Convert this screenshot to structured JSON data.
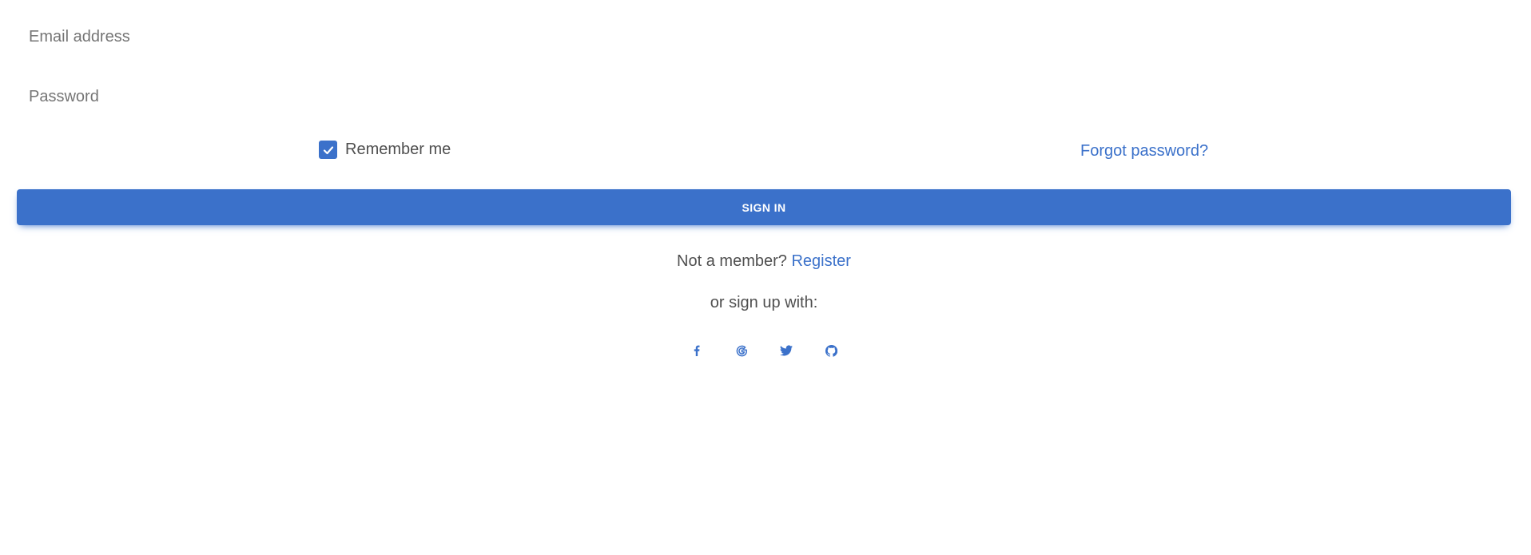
{
  "form": {
    "email": {
      "placeholder": "Email address",
      "value": ""
    },
    "password": {
      "placeholder": "Password",
      "value": ""
    },
    "remember_label": "Remember me",
    "remember_checked": true,
    "forgot_label": "Forgot password?",
    "signin_label": "SIGN IN"
  },
  "register": {
    "prompt": "Not a member?",
    "link_label": "Register"
  },
  "signup": {
    "text": "or sign up with:",
    "icons": [
      "facebook-icon",
      "google-icon",
      "twitter-icon",
      "github-icon"
    ]
  },
  "colors": {
    "primary": "#3b71ca",
    "text": "#4f4f4f",
    "placeholder": "#757575",
    "background": "#ffffff"
  }
}
